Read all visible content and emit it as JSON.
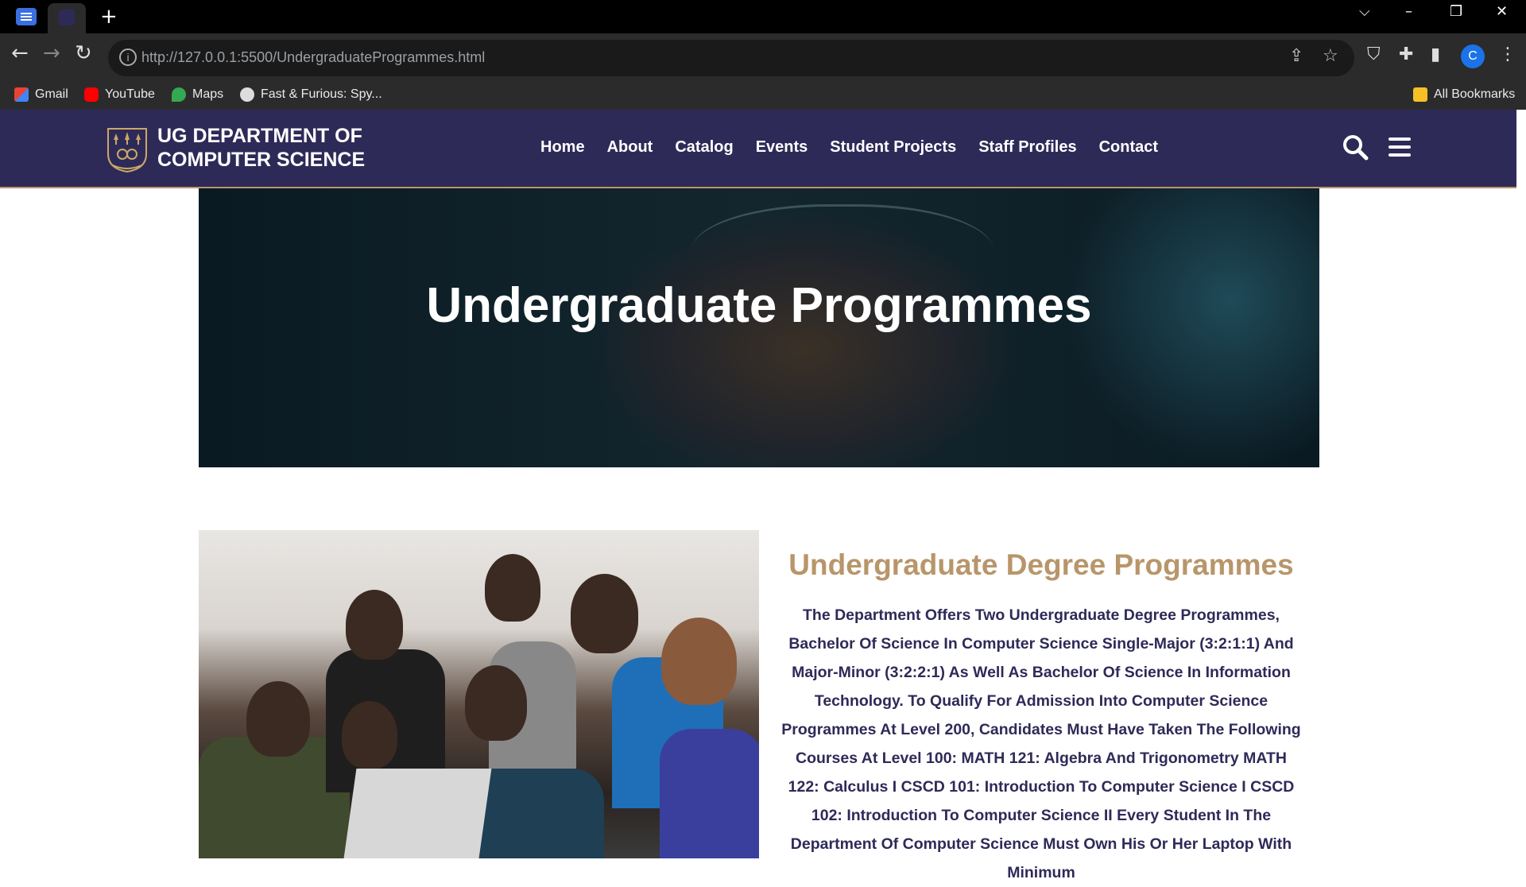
{
  "browser": {
    "address_url": "http://127.0.0.1:5500/UndergraduateProgrammes.html",
    "profile_initial": "C",
    "bookmarks": [
      {
        "label": "Gmail"
      },
      {
        "label": "YouTube"
      },
      {
        "label": "Maps"
      },
      {
        "label": "Fast & Furious: Spy..."
      }
    ],
    "all_bookmarks_label": "All Bookmarks"
  },
  "header": {
    "brand_line1": "UG DEPARTMENT OF",
    "brand_line2": "COMPUTER SCIENCE",
    "nav": [
      "Home",
      "About",
      "Catalog",
      "Events",
      "Student Projects",
      "Staff Profiles",
      "Contact"
    ]
  },
  "hero": {
    "title": "Undergraduate Programmes"
  },
  "section": {
    "title": "Undergraduate Degree Programmes",
    "text": "The Department Offers Two Undergraduate Degree Programmes, Bachelor Of Science In Computer Science Single-Major (3:2:1:1) And Major-Minor (3:2:2:1) As Well As Bachelor Of Science In Information Technology. To Qualify For Admission Into Computer Science Programmes At Level 200, Candidates Must Have Taken The Following Courses At Level 100: MATH 121: Algebra And Trigonometry MATH 122: Calculus I CSCD 101: Introduction To Computer Science I CSCD 102: Introduction To Computer Science II Every Student In The Department Of Computer Science Must Own His Or Her Laptop With Minimum"
  }
}
